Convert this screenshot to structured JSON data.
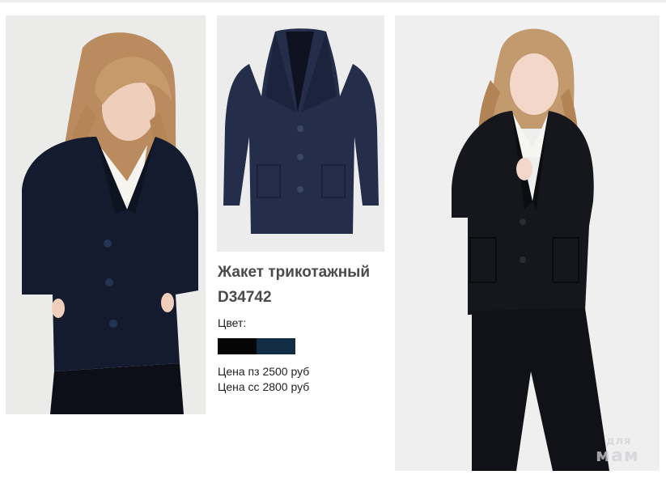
{
  "product": {
    "title": "Жакет трикотажный",
    "code": "D34742",
    "color_label": "Цвет:",
    "colors": [
      "#050505",
      "#132c46"
    ],
    "prices": [
      "Цена пз 2500 руб",
      "Цена сс 2800 руб"
    ]
  },
  "watermark": {
    "small": "для",
    "big": "мам"
  }
}
